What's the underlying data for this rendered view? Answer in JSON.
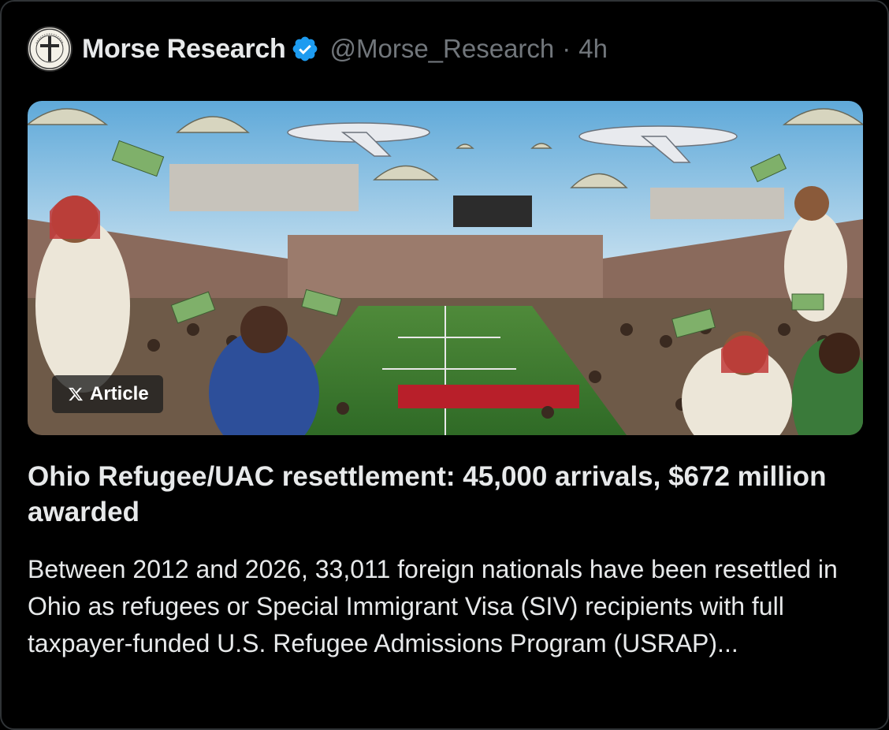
{
  "post": {
    "author": {
      "display_name": "Morse Research",
      "handle": "@Morse_Research",
      "verified": true,
      "avatar_icon": "morse-research-logo",
      "avatar_logo_text": "MORSE RESEARCH"
    },
    "separator": "·",
    "time_ago": "4h"
  },
  "article": {
    "badge_label": "Article",
    "badge_icon": "x-logo-icon",
    "image_description_icon": "stadium-illustration",
    "title": "Ohio Refugee/UAC resettlement: 45,000 arrivals, $672 million awarded",
    "excerpt": "Between 2012 and 2026, 33,011 foreign nationals have been resettled in Ohio as refugees or Special Immigrant Visa (SIV) recipients with full taxpayer-funded U.S. Refugee Admissions Program (USRAP)..."
  },
  "colors": {
    "background": "#000000",
    "text_primary": "#e7e9ea",
    "text_secondary": "#71767b",
    "verified_blue": "#1d9bf0",
    "border": "#2f3336"
  }
}
